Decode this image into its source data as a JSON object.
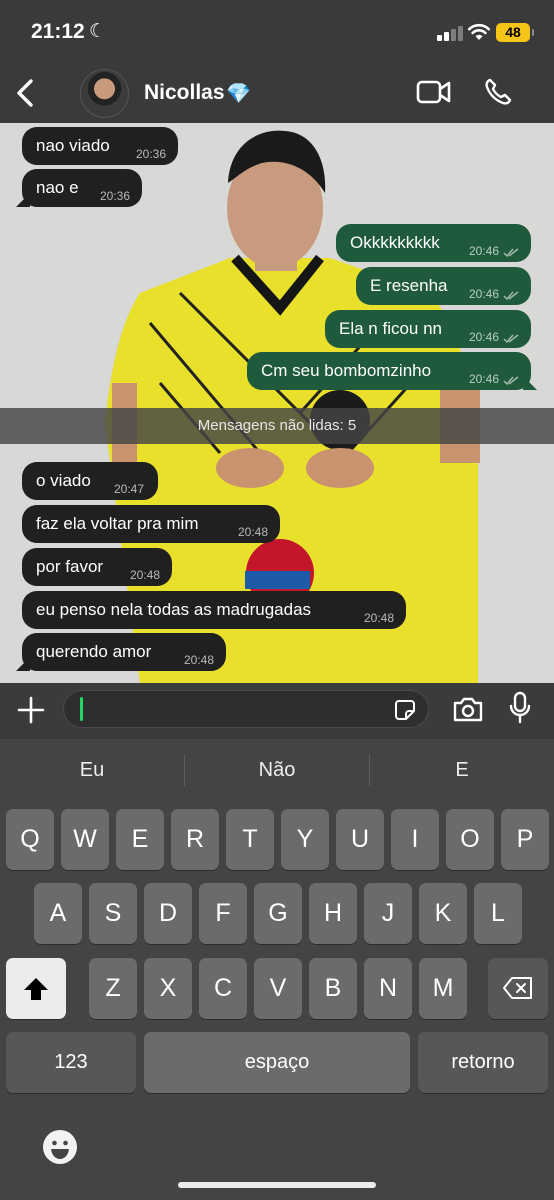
{
  "status_bar": {
    "time": "21:12",
    "battery": "48"
  },
  "header": {
    "contact_name": "Nicollas",
    "badge": "💎"
  },
  "messages": [
    {
      "text": "nao viado",
      "time": "20:36",
      "dir": "in"
    },
    {
      "text": "nao e",
      "time": "20:36",
      "dir": "in"
    },
    {
      "text": "Okkkkkkkkk",
      "time": "20:46",
      "dir": "out"
    },
    {
      "text": "E resenha",
      "time": "20:46",
      "dir": "out"
    },
    {
      "text": "Ela n ficou nn",
      "time": "20:46",
      "dir": "out"
    },
    {
      "text": "Cm seu bombomzinho",
      "time": "20:46",
      "dir": "out"
    },
    {
      "text": "o viado",
      "time": "20:47",
      "dir": "in"
    },
    {
      "text": "faz ela voltar pra mim",
      "time": "20:48",
      "dir": "in"
    },
    {
      "text": "por favor",
      "time": "20:48",
      "dir": "in"
    },
    {
      "text": "eu penso nela todas as madrugadas",
      "time": "20:48",
      "dir": "in"
    },
    {
      "text": "querendo amor",
      "time": "20:48",
      "dir": "in"
    }
  ],
  "unread_divider": "Mensagens não lidas: 5",
  "composer": {
    "value": ""
  },
  "keyboard": {
    "suggestions": [
      "Eu",
      "Não",
      "E"
    ],
    "row1": [
      "Q",
      "W",
      "E",
      "R",
      "T",
      "Y",
      "U",
      "I",
      "O",
      "P"
    ],
    "row2": [
      "A",
      "S",
      "D",
      "F",
      "G",
      "H",
      "J",
      "K",
      "L"
    ],
    "row3": [
      "Z",
      "X",
      "C",
      "V",
      "B",
      "N",
      "M"
    ],
    "numbers_label": "123",
    "space_label": "espaço",
    "return_label": "retorno"
  },
  "colors": {
    "outgoing_bubble": "#1e5a3b",
    "incoming_bubble": "#202020",
    "accent": "#25d366"
  }
}
